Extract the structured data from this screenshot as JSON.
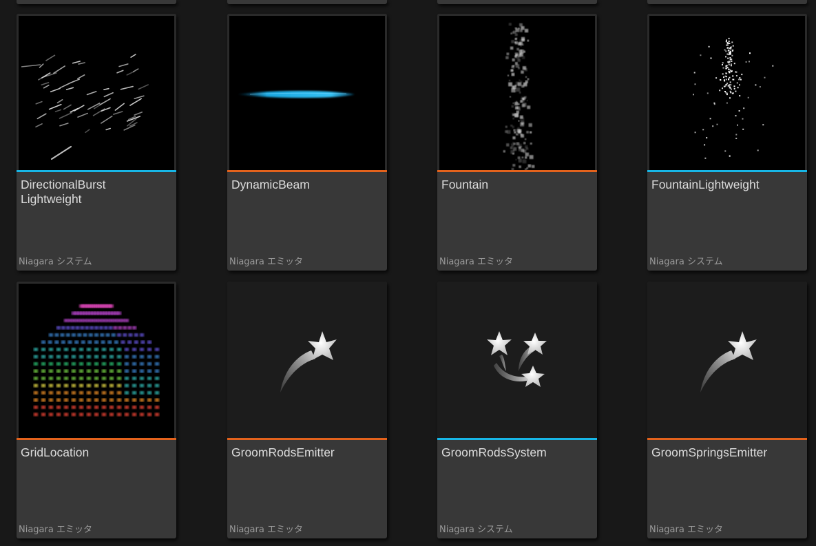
{
  "colors": {
    "background": "#181818",
    "tile": "#383838",
    "system_accent": "#17b6e6",
    "emitter_accent": "#e3621c",
    "name_text": "#dcdcdc",
    "type_text": "#9a9a9a"
  },
  "assets": [
    {
      "name": "DirectionalBurst\nLightweight",
      "type": "Niagara システム",
      "kind": "system",
      "thumbnail": "directional-burst-preview"
    },
    {
      "name": "DynamicBeam",
      "type": "Niagara エミッタ",
      "kind": "emitter",
      "thumbnail": "dynamic-beam-preview"
    },
    {
      "name": "Fountain",
      "type": "Niagara エミッタ",
      "kind": "emitter",
      "thumbnail": "fountain-preview"
    },
    {
      "name": "FountainLightweight",
      "type": "Niagara システム",
      "kind": "system",
      "thumbnail": "fountain-lightweight-preview"
    },
    {
      "name": "GridLocation",
      "type": "Niagara エミッタ",
      "kind": "emitter",
      "thumbnail": "grid-location-preview"
    },
    {
      "name": "GroomRodsEmitter",
      "type": "Niagara エミッタ",
      "kind": "emitter",
      "thumbnail": "shooting-star-icon"
    },
    {
      "name": "GroomRodsSystem",
      "type": "Niagara システム",
      "kind": "system",
      "thumbnail": "triple-shooting-stars-icon"
    },
    {
      "name": "GroomSpringsEmitter",
      "type": "Niagara エミッタ",
      "kind": "emitter",
      "thumbnail": "shooting-star-icon"
    }
  ]
}
